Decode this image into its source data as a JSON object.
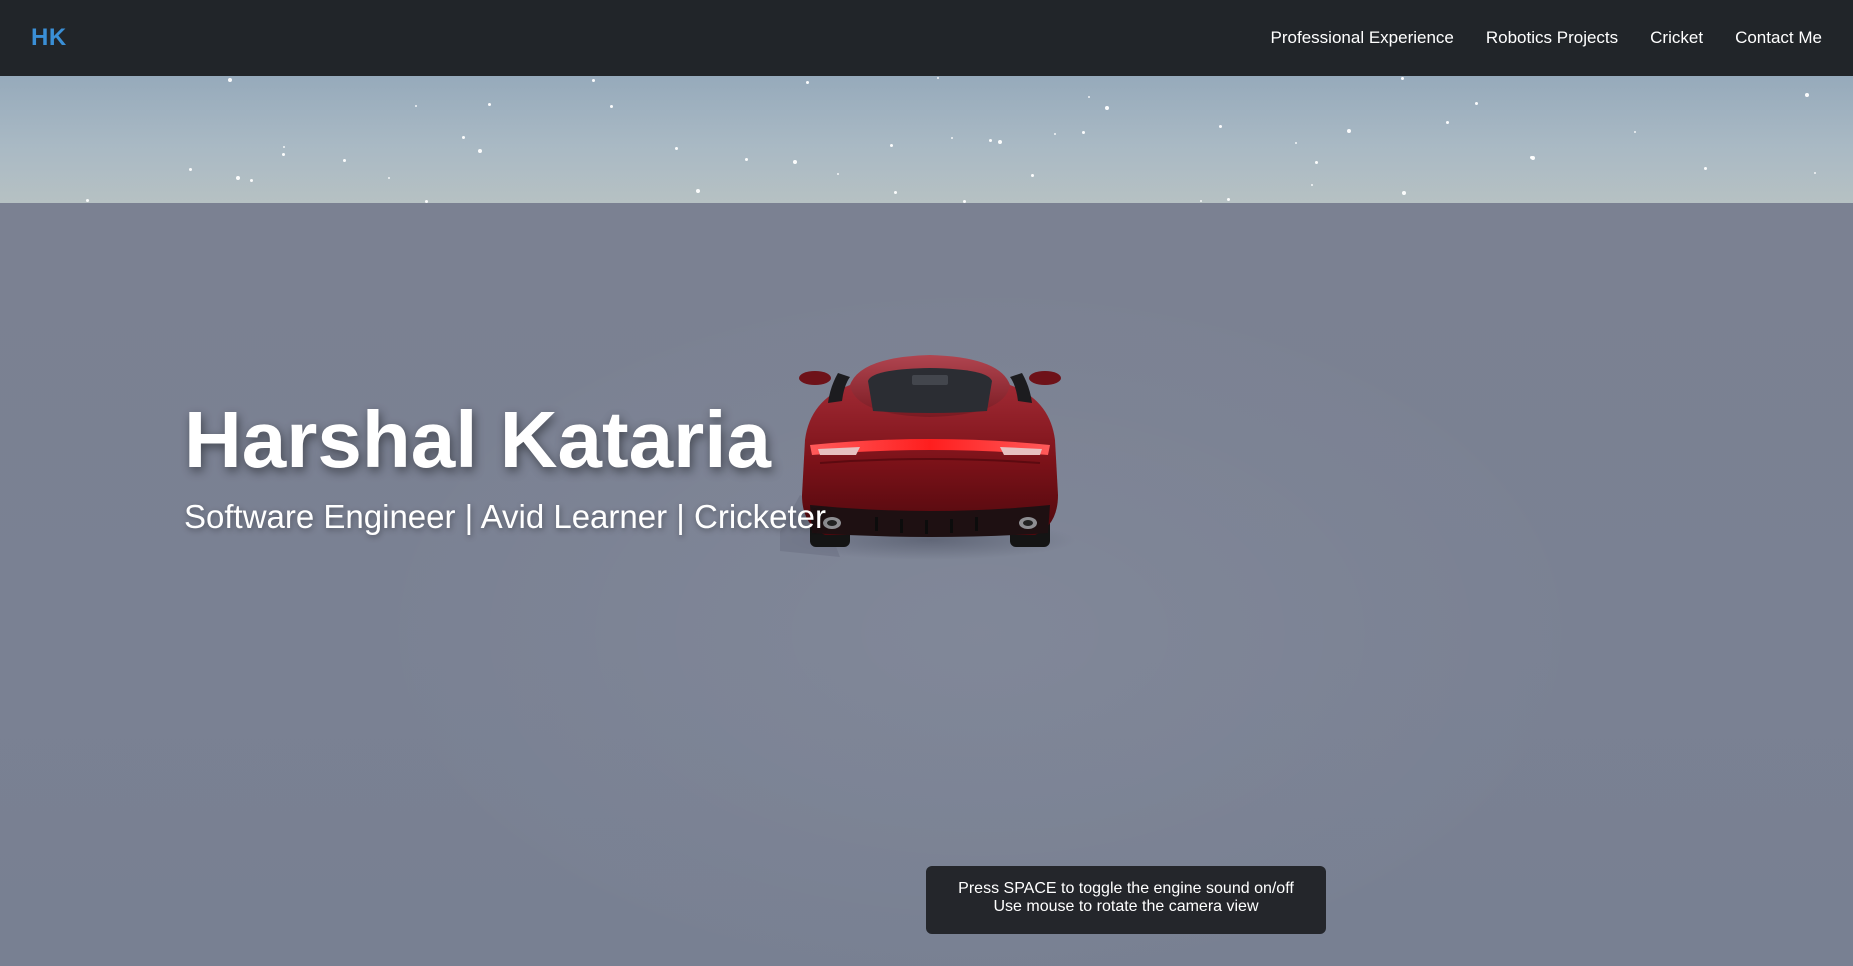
{
  "nav": {
    "brand": "HK",
    "links": [
      {
        "label": "Professional Experience"
      },
      {
        "label": "Robotics Projects"
      },
      {
        "label": "Cricket"
      },
      {
        "label": "Contact Me"
      }
    ]
  },
  "hero": {
    "title": "Harshal Kataria",
    "subtitle": "Software Engineer | Avid Learner | Cricketer"
  },
  "hint": {
    "line1": "Press SPACE to toggle the engine sound on/off",
    "line2": "Use mouse to rotate the camera view"
  },
  "colors": {
    "navbar_bg": "#212529",
    "brand": "#3a8fd6",
    "car_body": "#8b1820",
    "ground": "#7b8194",
    "hint_bg": "#24262b"
  }
}
